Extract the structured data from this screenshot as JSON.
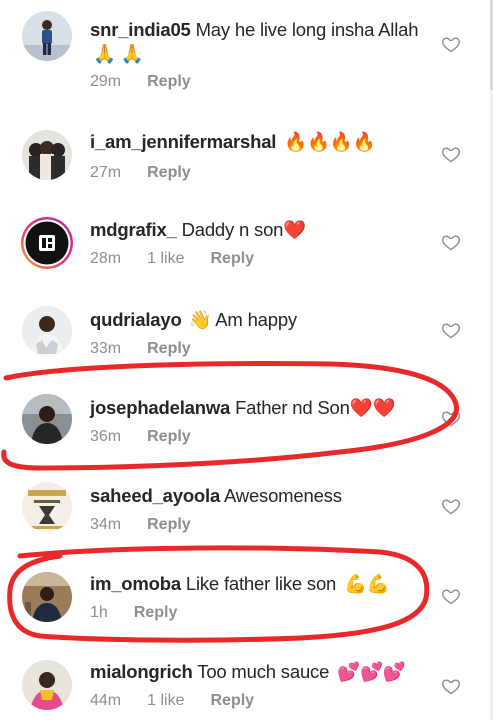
{
  "comments": [
    {
      "username": "snr_india05",
      "text": "May he live long insha Allah",
      "emoji": "🙏 🙏",
      "time": "29m",
      "likes": "",
      "reply": "Reply",
      "avatar_icon": "person-standing-avatar"
    },
    {
      "username": "i_am_jennifermarshal",
      "text": "",
      "emoji": "🔥🔥🔥🔥",
      "time": "27m",
      "likes": "",
      "reply": "Reply",
      "avatar_icon": "group-photo-avatar"
    },
    {
      "username": "mdgrafix_",
      "text": "Daddy n son",
      "emoji": "❤️",
      "time": "28m",
      "likes": "1 like",
      "reply": "Reply",
      "avatar_icon": "logo-avatar-with-story-ring"
    },
    {
      "username": "qudrialayo",
      "text": "",
      "emoji_prefix": "👋",
      "text_after": "Am happy",
      "time": "33m",
      "likes": "",
      "reply": "Reply",
      "avatar_icon": "person-avatar"
    },
    {
      "username": "josephadelanwa",
      "text": "Father nd Son",
      "emoji": "❤️❤️",
      "time": "36m",
      "likes": "",
      "reply": "Reply",
      "avatar_icon": "person-avatar"
    },
    {
      "username": "saheed_ayoola",
      "text": "Awesomeness",
      "emoji": "",
      "time": "34m",
      "likes": "",
      "reply": "Reply",
      "avatar_icon": "graphic-avatar"
    },
    {
      "username": "im_omoba",
      "text": "Like father like son",
      "emoji": "💪💪",
      "time": "1h",
      "likes": "",
      "reply": "Reply",
      "avatar_icon": "person-avatar"
    },
    {
      "username": "mialongrich",
      "text": "Too much sauce",
      "emoji": "💕💕💕",
      "time": "44m",
      "likes": "1 like",
      "reply": "Reply",
      "avatar_icon": "person-avatar"
    }
  ],
  "colors": {
    "text": "#262626",
    "meta": "#8e8e8e",
    "heart_outline": "#8e8e8e",
    "annotation_red": "#e8282b"
  }
}
